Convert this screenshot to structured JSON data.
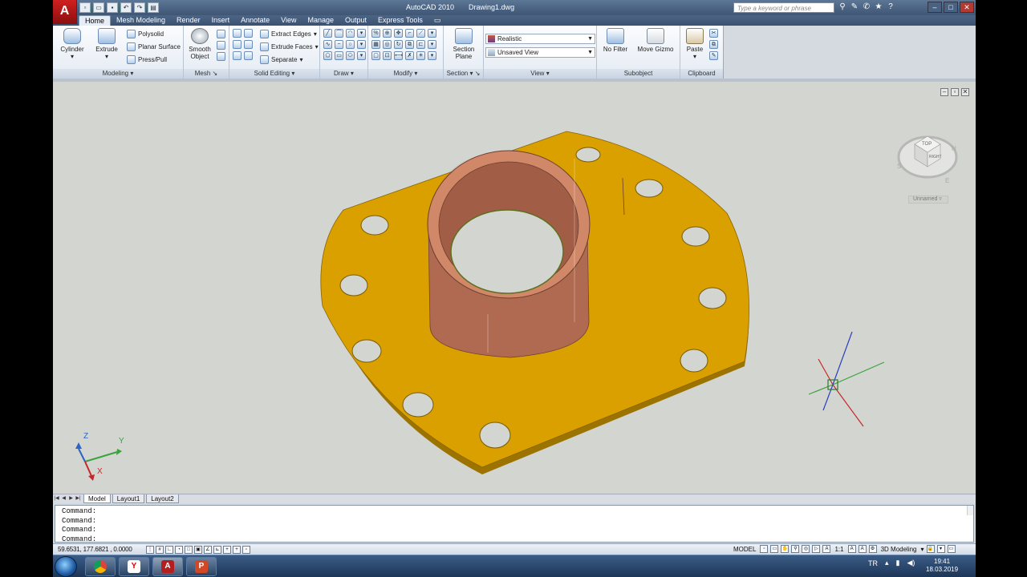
{
  "window": {
    "app_name": "AutoCAD 2010",
    "document": "Drawing1.dwg",
    "help_search_placeholder": "Type a keyword or phrase"
  },
  "app_logo": "A",
  "tabs": [
    "Home",
    "Mesh Modeling",
    "Render",
    "Insert",
    "Annotate",
    "View",
    "Manage",
    "Output",
    "Express Tools"
  ],
  "ribbon": {
    "modeling": {
      "title": "Modeling",
      "cylinder": "Cylinder",
      "extrude": "Extrude",
      "polysolid": "Polysolid",
      "planar_surface": "Planar Surface",
      "press_pull": "Press/Pull"
    },
    "mesh": {
      "title": "Mesh",
      "smooth_object_1": "Smooth",
      "smooth_object_2": "Object"
    },
    "solid_editing": {
      "title": "Solid Editing",
      "extract_edges": "Extract Edges",
      "extrude_faces": "Extrude Faces",
      "separate": "Separate"
    },
    "draw": {
      "title": "Draw"
    },
    "modify": {
      "title": "Modify"
    },
    "section": {
      "title": "Section",
      "section_plane_1": "Section",
      "section_plane_2": "Plane"
    },
    "view": {
      "title": "View",
      "visual_style": "Realistic",
      "named_view": "Unsaved View"
    },
    "subobject": {
      "title": "Subobject",
      "no_filter": "No Filter",
      "move_gizmo": "Move Gizmo"
    },
    "clipboard": {
      "title": "Clipboard",
      "paste": "Paste"
    }
  },
  "viewport": {
    "ucs_name": "Unnamed",
    "viewcube": {
      "top": "TOP",
      "right": "RIGHT",
      "n": "N",
      "e": "E",
      "s": "S"
    },
    "ucs_icon": {
      "x": "X",
      "y": "Y",
      "z": "Z"
    },
    "colors": {
      "plate": "#d9a000",
      "sleeve": "#b86a52",
      "background": "#d3d5d0"
    }
  },
  "layout_tabs": [
    "Model",
    "Layout1",
    "Layout2"
  ],
  "command_lines": [
    "Command:",
    "Command:",
    "Command:",
    "Command:"
  ],
  "status": {
    "coordinates": "59.6531, 177.6821 , 0.0000",
    "model": "MODEL",
    "annotation_scale": "1:1",
    "workspace": "3D Modeling"
  },
  "taskbar": {
    "language": "TR",
    "time": "19:41",
    "date": "18.03.2019"
  }
}
